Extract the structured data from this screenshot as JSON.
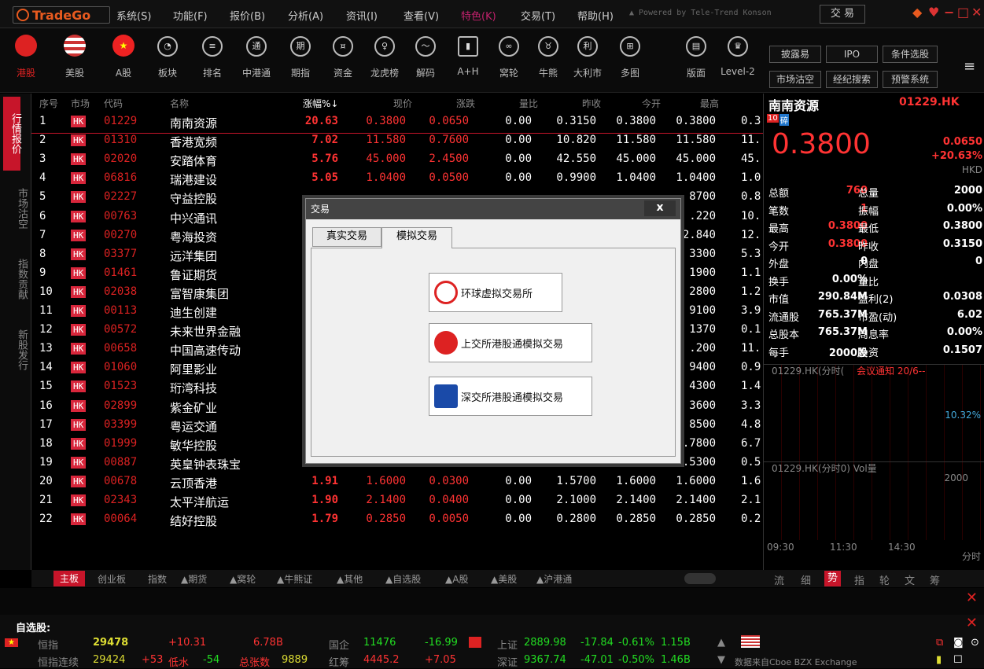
{
  "app": {
    "logo": "TradeGo",
    "powered": "▲ Powered by Tele-Trend Konson",
    "trade_button": "交 易"
  },
  "menu": [
    "系统(S)",
    "功能(F)",
    "报价(B)",
    "分析(A)",
    "资讯(I)",
    "查看(V)",
    "特色(K)",
    "交易(T)",
    "帮助(H)"
  ],
  "toolbar": {
    "items": [
      {
        "label": "港股",
        "icon": "hk-flag-icon"
      },
      {
        "label": "美股",
        "icon": "us-flag-icon"
      },
      {
        "label": "A股",
        "icon": "cn-flag-icon"
      },
      {
        "label": "板块",
        "icon": "pie-icon"
      },
      {
        "label": "排名",
        "icon": "rank-icon"
      },
      {
        "label": "中港通",
        "icon": "connect-icon"
      },
      {
        "label": "期指",
        "icon": "futures-icon"
      },
      {
        "label": "资金",
        "icon": "money-icon"
      },
      {
        "label": "龙虎榜",
        "icon": "dragon-icon"
      },
      {
        "label": "解码",
        "icon": "decode-icon"
      },
      {
        "label": "A+H",
        "icon": "ah-icon"
      },
      {
        "label": "窝轮",
        "icon": "warrant-icon"
      },
      {
        "label": "牛熊",
        "icon": "bullbear-icon"
      },
      {
        "label": "大利市",
        "icon": "profit-icon"
      },
      {
        "label": "多图",
        "icon": "multi-chart-icon"
      },
      {
        "label": "版面",
        "icon": "layout-icon"
      },
      {
        "label": "Level-2",
        "icon": "crown-icon"
      }
    ],
    "right_buttons": [
      "披露易",
      "IPO",
      "条件选股",
      "市场沽空",
      "经纪搜索",
      "预警系统"
    ]
  },
  "left_tabs": [
    "行情报价",
    "市场沽空",
    "指数贡献",
    "新股发行"
  ],
  "table": {
    "headers": [
      "序号",
      "市场",
      "代码",
      "名称",
      "涨幅%↓",
      "现价",
      "涨跌",
      "量比",
      "昨收",
      "今开",
      "最高"
    ],
    "rows": [
      [
        "1",
        "HK",
        "01229",
        "南南资源",
        "20.63",
        "0.3800",
        "0.0650",
        "0.00",
        "0.3150",
        "0.3800",
        "0.3800",
        "0.3"
      ],
      [
        "2",
        "HK",
        "01310",
        "香港宽频",
        "7.02",
        "11.580",
        "0.7600",
        "0.00",
        "10.820",
        "11.580",
        "11.580",
        "11."
      ],
      [
        "3",
        "HK",
        "02020",
        "安踏体育",
        "5.76",
        "45.000",
        "2.4500",
        "0.00",
        "42.550",
        "45.000",
        "45.000",
        "45."
      ],
      [
        "4",
        "HK",
        "06816",
        "瑞港建设",
        "5.05",
        "1.0400",
        "0.0500",
        "0.00",
        "0.9900",
        "1.0400",
        "1.0400",
        "1.0"
      ],
      [
        "5",
        "HK",
        "02227",
        "守益控股",
        "",
        "",
        "",
        "",
        "",
        "",
        "8700",
        "0.8"
      ],
      [
        "6",
        "HK",
        "00763",
        "中兴通讯",
        "",
        "",
        "",
        "",
        "",
        "",
        ".220",
        "10."
      ],
      [
        "7",
        "HK",
        "00270",
        "粤海投资",
        "",
        "",
        "",
        "",
        "",
        "",
        "2.840",
        "12."
      ],
      [
        "8",
        "HK",
        "03377",
        "远洋集团",
        "",
        "",
        "",
        "",
        "",
        "",
        "3300",
        "5.3"
      ],
      [
        "9",
        "HK",
        "01461",
        "鲁证期货",
        "",
        "",
        "",
        "",
        "",
        "",
        "1900",
        "1.1"
      ],
      [
        "10",
        "HK",
        "02038",
        "富智康集团",
        "",
        "",
        "",
        "",
        "",
        "",
        "2800",
        "1.2"
      ],
      [
        "11",
        "HK",
        "00113",
        "迪生创建",
        "",
        "",
        "",
        "",
        "",
        "",
        "9100",
        "3.9"
      ],
      [
        "12",
        "HK",
        "00572",
        "未来世界金融",
        "",
        "",
        "",
        "",
        "",
        "",
        "1370",
        "0.1"
      ],
      [
        "13",
        "HK",
        "00658",
        "中国高速传动",
        "",
        "",
        "",
        "",
        "",
        "",
        ".200",
        "11."
      ],
      [
        "14",
        "HK",
        "01060",
        "阿里影业",
        "",
        "",
        "",
        "",
        "",
        "",
        "9400",
        "0.9"
      ],
      [
        "15",
        "HK",
        "01523",
        "珩湾科技",
        "",
        "",
        "",
        "",
        "",
        "",
        "4300",
        "1.4"
      ],
      [
        "16",
        "HK",
        "02899",
        "紫金矿业",
        "",
        "",
        "",
        "",
        "",
        "",
        "3600",
        "3.3"
      ],
      [
        "17",
        "HK",
        "03399",
        "粤运交通",
        "",
        "",
        "",
        "",
        "",
        "",
        "8500",
        "4.8"
      ],
      [
        "18",
        "HK",
        "01999",
        "敏华控股",
        "1.95",
        "6.7800",
        "0.1300",
        "0.00",
        "6.6500",
        "6.7800",
        "6.7800",
        "6.7"
      ],
      [
        "19",
        "HK",
        "00887",
        "英皇钟表珠宝",
        "1.92",
        "0.5300",
        "0.0100",
        "0.00",
        "0.5200",
        "0.5300",
        "0.5300",
        "0.5"
      ],
      [
        "20",
        "HK",
        "00678",
        "云顶香港",
        "1.91",
        "1.6000",
        "0.0300",
        "0.00",
        "1.5700",
        "1.6000",
        "1.6000",
        "1.6"
      ],
      [
        "21",
        "HK",
        "02343",
        "太平洋航运",
        "1.90",
        "2.1400",
        "0.0400",
        "0.00",
        "2.1000",
        "2.1400",
        "2.1400",
        "2.1"
      ],
      [
        "22",
        "HK",
        "00064",
        "结好控股",
        "1.79",
        "0.2850",
        "0.0050",
        "0.00",
        "0.2800",
        "0.2850",
        "0.2850",
        "0.2"
      ]
    ]
  },
  "dialog": {
    "title": "交易",
    "close": "x",
    "tabs": [
      "真实交易",
      "模拟交易"
    ],
    "buttons": [
      "环球虚拟交易所",
      "上交所港股通模拟交易",
      "深交所港股通模拟交易"
    ]
  },
  "bottom_tabs": [
    "主板",
    "创业板",
    "指数",
    "▲期货",
    "▲窝轮",
    "▲牛熊证",
    "▲其他",
    "▲自选股",
    "▲A股",
    "▲美股",
    "▲沪港通"
  ],
  "right_tabs": [
    "流",
    "细",
    "势",
    "指",
    "轮",
    "文",
    "筹"
  ],
  "quote": {
    "name": "南南资源",
    "code": "01229.HK",
    "badge1": "10",
    "badge2": "碎",
    "price": "0.3800",
    "change": "0.0650",
    "pct": "+20.63%",
    "currency": "HKD",
    "fields": [
      [
        "总额",
        "760",
        "总量",
        "2000"
      ],
      [
        "笔数",
        "1",
        "振幅",
        "0.00%"
      ],
      [
        "最高",
        "0.3800",
        "最低",
        "0.3800"
      ],
      [
        "今开",
        "0.3800",
        "昨收",
        "0.3150"
      ],
      [
        "外盘",
        "0",
        "内盘",
        "0"
      ],
      [
        "换手",
        "0.00%",
        "量比",
        ""
      ],
      [
        "市值",
        "290.84M",
        "盈利(2)",
        "0.0308"
      ],
      [
        "流通股",
        "765.37M",
        "市盈(动)",
        "6.02"
      ],
      [
        "总股本",
        "765.37M",
        "周息率",
        "0.00%"
      ],
      [
        "每手",
        "2000股",
        "净资",
        "0.1507"
      ]
    ],
    "chart1_title": "01229.HK(分时(",
    "chart1_notice": "会议通知 20/6--",
    "chart1_pct": "10.32%",
    "chart2_title": "01229.HK(分时0) Vol量",
    "chart2_vol": "2000",
    "times": [
      "09:30",
      "11:30",
      "14:30"
    ],
    "mode": "分时"
  },
  "status": {
    "watch_title": "自选股:",
    "row1": {
      "a_label": "恒指",
      "a_val": "29478",
      "a_chg": "+10.31",
      "a_amt": "6.78B",
      "b_label": "国企",
      "b_val": "11476",
      "b_chg": "-16.99",
      "c_label": "上证",
      "c_val": "2889.98",
      "c_chg": "-17.84",
      "c_pct": "-0.61%",
      "c_amt": "1.15B"
    },
    "row2": {
      "a_label": "恒指连续",
      "a_val": "29424",
      "a_chg": "+53",
      "a_low_label": "低水",
      "a_low": "-54",
      "a_count_label": "总张数",
      "a_count": "9889",
      "b_label": "红筹",
      "b_val": "4445.2",
      "b_chg": "+7.05",
      "c_label": "深证",
      "c_val": "9367.74",
      "c_chg": "-47.01",
      "c_pct": "-0.50%",
      "c_amt": "1.46B"
    },
    "source": "数据来自Cboe BZX Exchange"
  },
  "colors": {
    "up": "#ff3333",
    "down": "#22dd22",
    "accent": "#c7152a"
  }
}
